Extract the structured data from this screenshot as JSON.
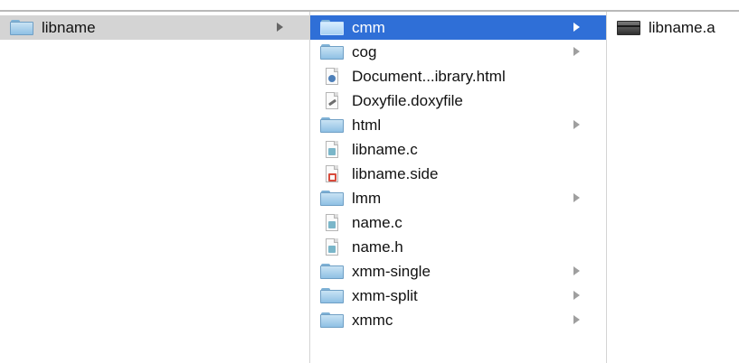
{
  "colors": {
    "selected_blue": "#2f6fd7",
    "selected_gray": "#d4d4d4",
    "folder": "#8fc0e4"
  },
  "column1": {
    "items": [
      {
        "label": "libname",
        "icon": "folder-icon",
        "has_children": true,
        "state": "selected-inactive"
      }
    ]
  },
  "column2": {
    "items": [
      {
        "label": "cmm",
        "icon": "folder-icon",
        "has_children": true,
        "state": "selected-active"
      },
      {
        "label": "cog",
        "icon": "folder-icon",
        "has_children": true
      },
      {
        "label": "Document...ibrary.html",
        "icon": "html-file-icon",
        "has_children": false
      },
      {
        "label": "Doxyfile.doxyfile",
        "icon": "script-file-icon",
        "has_children": false
      },
      {
        "label": "html",
        "icon": "folder-icon",
        "has_children": true
      },
      {
        "label": "libname.c",
        "icon": "c-source-file-icon",
        "has_children": false
      },
      {
        "label": "libname.side",
        "icon": "pdf-file-icon",
        "has_children": false
      },
      {
        "label": "lmm",
        "icon": "folder-icon",
        "has_children": true
      },
      {
        "label": "name.c",
        "icon": "c-source-file-icon",
        "has_children": false
      },
      {
        "label": "name.h",
        "icon": "header-file-icon",
        "has_children": false
      },
      {
        "label": "xmm-single",
        "icon": "folder-icon",
        "has_children": true
      },
      {
        "label": "xmm-split",
        "icon": "folder-icon",
        "has_children": true
      },
      {
        "label": "xmmc",
        "icon": "folder-icon",
        "has_children": true
      }
    ]
  },
  "column3": {
    "items": [
      {
        "label": "libname.a",
        "icon": "archive-file-icon",
        "has_children": false
      }
    ]
  }
}
